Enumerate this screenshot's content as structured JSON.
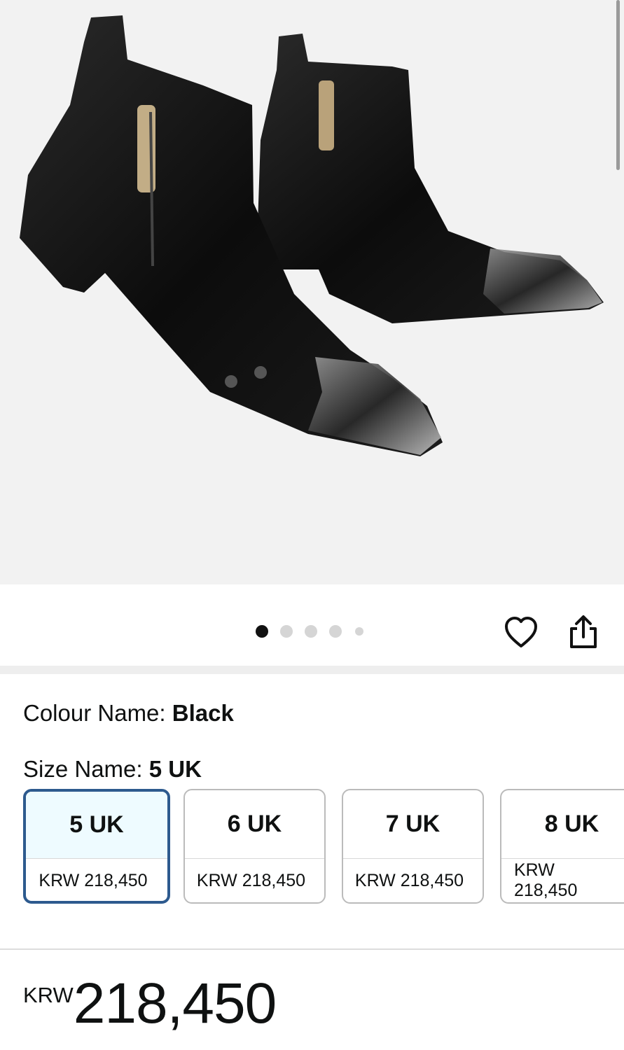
{
  "gallery": {
    "image_alt": "Black leather ankle boots with metal toe caps",
    "dot_count": 5,
    "active_dot": 0
  },
  "actions": {
    "favorite_icon": "heart-icon",
    "share_icon": "share-icon"
  },
  "colour": {
    "label": "Colour Name: ",
    "value": "Black"
  },
  "size": {
    "label": "Size Name: ",
    "value": "5 UK",
    "options": [
      {
        "size": "5 UK",
        "price": "KRW 218,450",
        "selected": true
      },
      {
        "size": "6 UK",
        "price": "KRW 218,450",
        "selected": false
      },
      {
        "size": "7 UK",
        "price": "KRW 218,450",
        "selected": false
      },
      {
        "size": "8 UK",
        "price": "KRW 218,450",
        "selected": false
      }
    ]
  },
  "price": {
    "currency": "KRW",
    "amount": "218,450"
  },
  "colors": {
    "selected_border": "#2d5a8e",
    "selected_fill": "#eefbff",
    "hero_bg": "#f2f2f2"
  }
}
